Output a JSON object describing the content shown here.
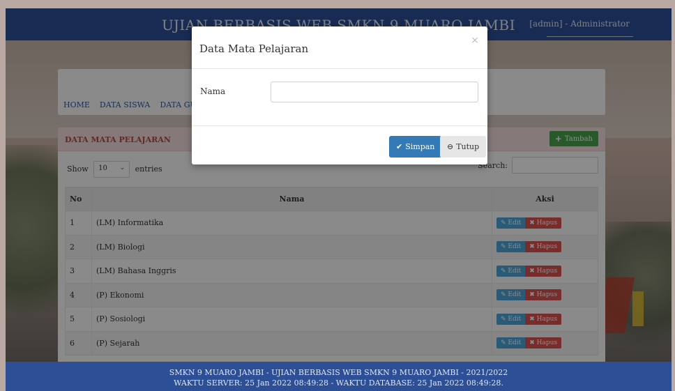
{
  "header": {
    "title": "UJIAN BERBASIS WEB SMKN 9 MUARO JAMBI",
    "user": "[admin] - Administrator"
  },
  "nav": {
    "items": [
      "HOME",
      "DATA SISWA",
      "DATA GURU"
    ]
  },
  "panel": {
    "title": "DATA MATA PELAJARAN",
    "add_label": "Tambah",
    "show_label": "Show",
    "entries_value": "10",
    "entries_label": "entries",
    "search_label": "Search:"
  },
  "table": {
    "headers": [
      "No",
      "Nama",
      "Aksi"
    ],
    "edit_label": "Edit",
    "delete_label": "Hapus",
    "rows": [
      {
        "no": "1",
        "nama": "(LM) Informatika"
      },
      {
        "no": "2",
        "nama": "(LM) Biologi"
      },
      {
        "no": "3",
        "nama": "(LM) Bahasa Inggris"
      },
      {
        "no": "4",
        "nama": "(P) Ekonomi"
      },
      {
        "no": "5",
        "nama": "(P) Sosiologi"
      },
      {
        "no": "6",
        "nama": "(P) Sejarah"
      }
    ]
  },
  "modal": {
    "title": "Data Mata Pelajaran",
    "close_symbol": "×",
    "field_label": "Nama",
    "field_value": "",
    "save_label": "Simpan",
    "cancel_label": "Tutup"
  },
  "footer": {
    "line1": "SMKN 9 MUARO JAMBI - UJIAN BERBASIS WEB SMKN 9 MUARO JAMBI - 2021/2022",
    "line2": "WAKTU SERVER: 25 Jan 2022 08:49:28 - WAKTU DATABASE: 25 Jan 2022 08:49:28."
  },
  "colors": {
    "header_bg": "#2d4f95",
    "panel_head_bg": "#f4dcdc",
    "save_button": "#337ab7",
    "edit_button": "#4ea7d8",
    "delete_button": "#d9534f",
    "add_button": "#4aa34a"
  },
  "icons": {
    "save": "check-icon",
    "cancel": "minus-circle-icon",
    "add": "plus-icon",
    "edit": "pencil-icon",
    "delete": "x-icon"
  }
}
